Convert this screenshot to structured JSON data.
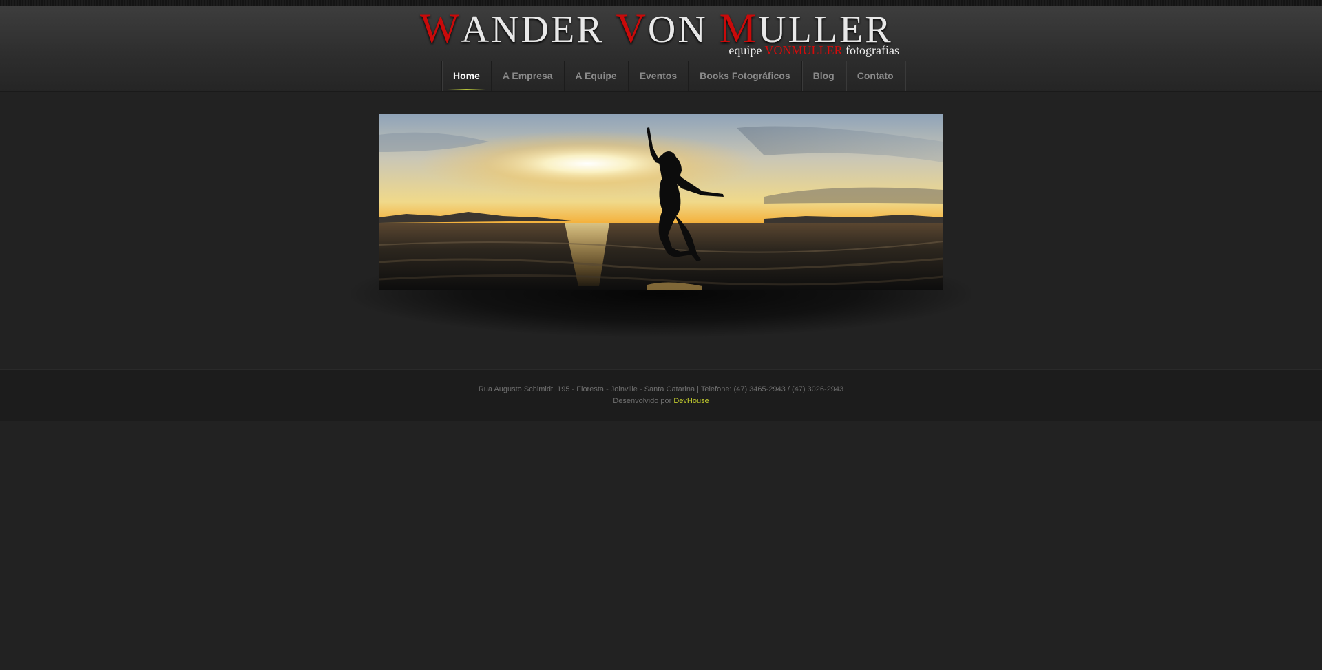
{
  "brand": {
    "title_parts": [
      {
        "cap": "W",
        "rest": "ANDER"
      },
      {
        "cap": "V",
        "rest": "ON"
      },
      {
        "cap": "M",
        "rest": "ULLER"
      }
    ],
    "subtitle_prefix": "equipe",
    "subtitle_highlight": "VONMULLER",
    "subtitle_suffix": "fotografias",
    "accent_color": "#c90a0a"
  },
  "nav": {
    "items": [
      {
        "label": "Home",
        "active": true
      },
      {
        "label": "A Empresa",
        "active": false
      },
      {
        "label": "A Equipe",
        "active": false
      },
      {
        "label": "Eventos",
        "active": false
      },
      {
        "label": "Books Fotográficos",
        "active": false
      },
      {
        "label": "Blog",
        "active": false
      },
      {
        "label": "Contato",
        "active": false
      }
    ]
  },
  "footer": {
    "address": "Rua Augusto Schimidt, 195 - Floresta - Joinville - Santa Catarina | Telefone: (47) 3465-2943 / (47) 3026-2943",
    "developed_by": "Desenvolvido por",
    "developer": "DevHouse",
    "link_color": "#c4ce2e"
  }
}
